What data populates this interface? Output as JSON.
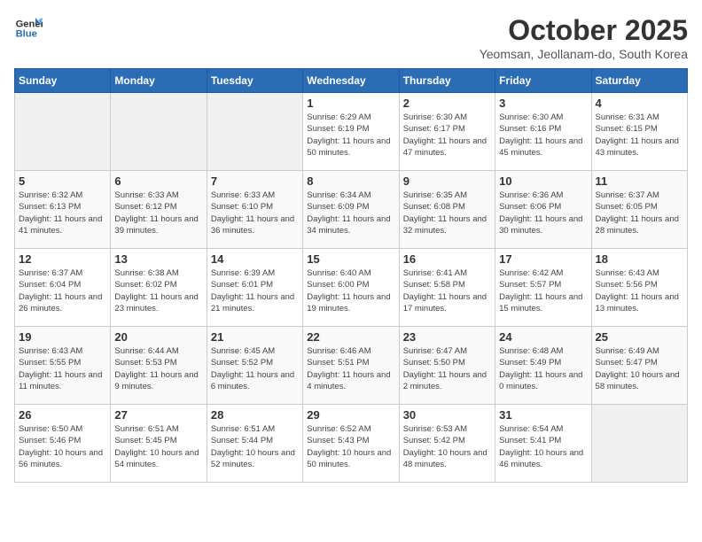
{
  "header": {
    "logo_general": "General",
    "logo_blue": "Blue",
    "month": "October 2025",
    "location": "Yeomsan, Jeollanam-do, South Korea"
  },
  "weekdays": [
    "Sunday",
    "Monday",
    "Tuesday",
    "Wednesday",
    "Thursday",
    "Friday",
    "Saturday"
  ],
  "weeks": [
    [
      {
        "day": "",
        "empty": true
      },
      {
        "day": "",
        "empty": true
      },
      {
        "day": "",
        "empty": true
      },
      {
        "day": "1",
        "sunrise": "6:29 AM",
        "sunset": "6:19 PM",
        "daylight": "11 hours and 50 minutes."
      },
      {
        "day": "2",
        "sunrise": "6:30 AM",
        "sunset": "6:17 PM",
        "daylight": "11 hours and 47 minutes."
      },
      {
        "day": "3",
        "sunrise": "6:30 AM",
        "sunset": "6:16 PM",
        "daylight": "11 hours and 45 minutes."
      },
      {
        "day": "4",
        "sunrise": "6:31 AM",
        "sunset": "6:15 PM",
        "daylight": "11 hours and 43 minutes."
      }
    ],
    [
      {
        "day": "5",
        "sunrise": "6:32 AM",
        "sunset": "6:13 PM",
        "daylight": "11 hours and 41 minutes."
      },
      {
        "day": "6",
        "sunrise": "6:33 AM",
        "sunset": "6:12 PM",
        "daylight": "11 hours and 39 minutes."
      },
      {
        "day": "7",
        "sunrise": "6:33 AM",
        "sunset": "6:10 PM",
        "daylight": "11 hours and 36 minutes."
      },
      {
        "day": "8",
        "sunrise": "6:34 AM",
        "sunset": "6:09 PM",
        "daylight": "11 hours and 34 minutes."
      },
      {
        "day": "9",
        "sunrise": "6:35 AM",
        "sunset": "6:08 PM",
        "daylight": "11 hours and 32 minutes."
      },
      {
        "day": "10",
        "sunrise": "6:36 AM",
        "sunset": "6:06 PM",
        "daylight": "11 hours and 30 minutes."
      },
      {
        "day": "11",
        "sunrise": "6:37 AM",
        "sunset": "6:05 PM",
        "daylight": "11 hours and 28 minutes."
      }
    ],
    [
      {
        "day": "12",
        "sunrise": "6:37 AM",
        "sunset": "6:04 PM",
        "daylight": "11 hours and 26 minutes."
      },
      {
        "day": "13",
        "sunrise": "6:38 AM",
        "sunset": "6:02 PM",
        "daylight": "11 hours and 23 minutes."
      },
      {
        "day": "14",
        "sunrise": "6:39 AM",
        "sunset": "6:01 PM",
        "daylight": "11 hours and 21 minutes."
      },
      {
        "day": "15",
        "sunrise": "6:40 AM",
        "sunset": "6:00 PM",
        "daylight": "11 hours and 19 minutes."
      },
      {
        "day": "16",
        "sunrise": "6:41 AM",
        "sunset": "5:58 PM",
        "daylight": "11 hours and 17 minutes."
      },
      {
        "day": "17",
        "sunrise": "6:42 AM",
        "sunset": "5:57 PM",
        "daylight": "11 hours and 15 minutes."
      },
      {
        "day": "18",
        "sunrise": "6:43 AM",
        "sunset": "5:56 PM",
        "daylight": "11 hours and 13 minutes."
      }
    ],
    [
      {
        "day": "19",
        "sunrise": "6:43 AM",
        "sunset": "5:55 PM",
        "daylight": "11 hours and 11 minutes."
      },
      {
        "day": "20",
        "sunrise": "6:44 AM",
        "sunset": "5:53 PM",
        "daylight": "11 hours and 9 minutes."
      },
      {
        "day": "21",
        "sunrise": "6:45 AM",
        "sunset": "5:52 PM",
        "daylight": "11 hours and 6 minutes."
      },
      {
        "day": "22",
        "sunrise": "6:46 AM",
        "sunset": "5:51 PM",
        "daylight": "11 hours and 4 minutes."
      },
      {
        "day": "23",
        "sunrise": "6:47 AM",
        "sunset": "5:50 PM",
        "daylight": "11 hours and 2 minutes."
      },
      {
        "day": "24",
        "sunrise": "6:48 AM",
        "sunset": "5:49 PM",
        "daylight": "11 hours and 0 minutes."
      },
      {
        "day": "25",
        "sunrise": "6:49 AM",
        "sunset": "5:47 PM",
        "daylight": "10 hours and 58 minutes."
      }
    ],
    [
      {
        "day": "26",
        "sunrise": "6:50 AM",
        "sunset": "5:46 PM",
        "daylight": "10 hours and 56 minutes."
      },
      {
        "day": "27",
        "sunrise": "6:51 AM",
        "sunset": "5:45 PM",
        "daylight": "10 hours and 54 minutes."
      },
      {
        "day": "28",
        "sunrise": "6:51 AM",
        "sunset": "5:44 PM",
        "daylight": "10 hours and 52 minutes."
      },
      {
        "day": "29",
        "sunrise": "6:52 AM",
        "sunset": "5:43 PM",
        "daylight": "10 hours and 50 minutes."
      },
      {
        "day": "30",
        "sunrise": "6:53 AM",
        "sunset": "5:42 PM",
        "daylight": "10 hours and 48 minutes."
      },
      {
        "day": "31",
        "sunrise": "6:54 AM",
        "sunset": "5:41 PM",
        "daylight": "10 hours and 46 minutes."
      },
      {
        "day": "",
        "empty": true
      }
    ]
  ]
}
